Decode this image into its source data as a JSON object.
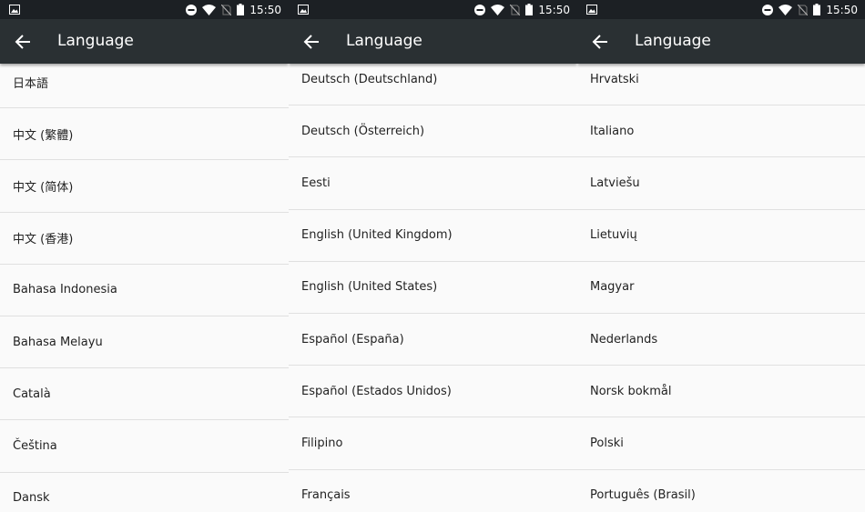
{
  "status": {
    "time": "15:50"
  },
  "screens": [
    {
      "title": "Language",
      "items": [
        "日本語",
        "中文 (繁體)",
        "中文 (简体)",
        "中文 (香港)",
        "Bahasa Indonesia",
        "Bahasa Melayu",
        "Català",
        "Čeština",
        "Dansk"
      ]
    },
    {
      "title": "Language",
      "items": [
        "Deutsch (Deutschland)",
        "Deutsch (Österreich)",
        "Eesti",
        "English (United Kingdom)",
        "English (United States)",
        "Español (España)",
        "Español (Estados Unidos)",
        "Filipino",
        "Français"
      ]
    },
    {
      "title": "Language",
      "items": [
        "Hrvatski",
        "Italiano",
        "Latviešu",
        "Lietuvių",
        "Magyar",
        "Nederlands",
        "Norsk bokmål",
        "Polski",
        "Português (Brasil)"
      ]
    }
  ],
  "icons": {
    "status_left": "image-icon",
    "status_right": [
      "do-not-disturb-icon",
      "wifi-icon",
      "no-sim-icon",
      "battery-icon"
    ],
    "back": "arrow-back-icon"
  },
  "colors": {
    "status_bar": "#1c2024",
    "app_bar": "#2a3033",
    "list_bg": "#fafafa",
    "divider": "#e0e0e0",
    "text": "#222222"
  }
}
